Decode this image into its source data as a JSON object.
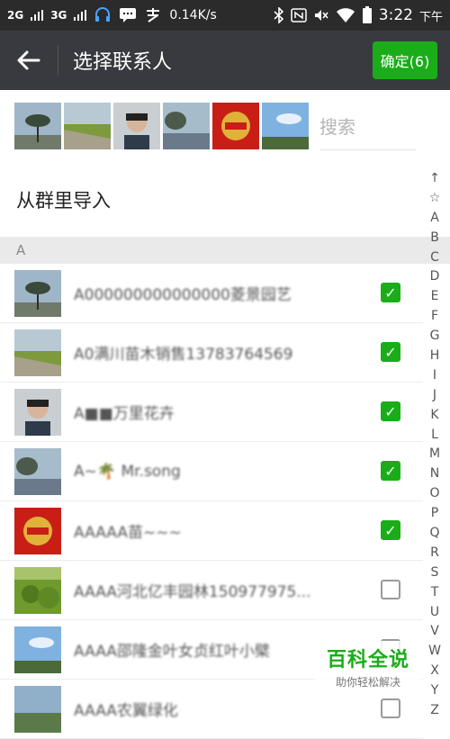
{
  "status_bar": {
    "left": [
      {
        "label": "2G",
        "icon": "signal-icon"
      },
      {
        "label": "3G",
        "icon": "signal-icon"
      }
    ],
    "icons": [
      "headset-icon",
      "message-icon",
      "alipay-icon"
    ],
    "speed": "0.14K/s",
    "right_icons": [
      "bluetooth-icon",
      "nfc-icon",
      "mute-icon",
      "wifi-icon",
      "battery-icon"
    ],
    "time": "3:22",
    "ampm": "下午"
  },
  "appbar": {
    "back_icon": "arrow-left-icon",
    "title": "选择联系人",
    "confirm_label": "确定(6)",
    "confirm_color": "#1aad19"
  },
  "selected": {
    "avatar_count": 6,
    "search_placeholder": "搜索"
  },
  "import_label": "从群里导入",
  "section_letter": "A",
  "contacts": [
    {
      "name": "A000000000000000菱景园艺",
      "checked": true
    },
    {
      "name": "A0满川苗木销售13783764569",
      "checked": true
    },
    {
      "name": "A■■万里花卉",
      "checked": true
    },
    {
      "name": "A~🌴 Mr.song",
      "checked": true
    },
    {
      "name": "AAAAA苗~~~",
      "checked": true
    },
    {
      "name": "AAAA河北亿丰园林150977975...",
      "checked": false
    },
    {
      "name": "AAAA邵隆金叶女贞红叶小檗",
      "checked": false
    },
    {
      "name": "AAAA农翼绿化",
      "checked": false
    }
  ],
  "index_letters": [
    "↑",
    "☆",
    "A",
    "B",
    "C",
    "D",
    "E",
    "F",
    "G",
    "H",
    "I",
    "J",
    "K",
    "L",
    "M",
    "N",
    "O",
    "P",
    "Q",
    "R",
    "S",
    "T",
    "U",
    "V",
    "W",
    "X",
    "Y",
    "Z"
  ],
  "watermark": {
    "title": "百科全说",
    "subtitle": "助你轻松解决"
  },
  "colors": {
    "accent": "#1aad19",
    "appbar": "#393a3f",
    "statusbar": "#2b2b2b"
  }
}
